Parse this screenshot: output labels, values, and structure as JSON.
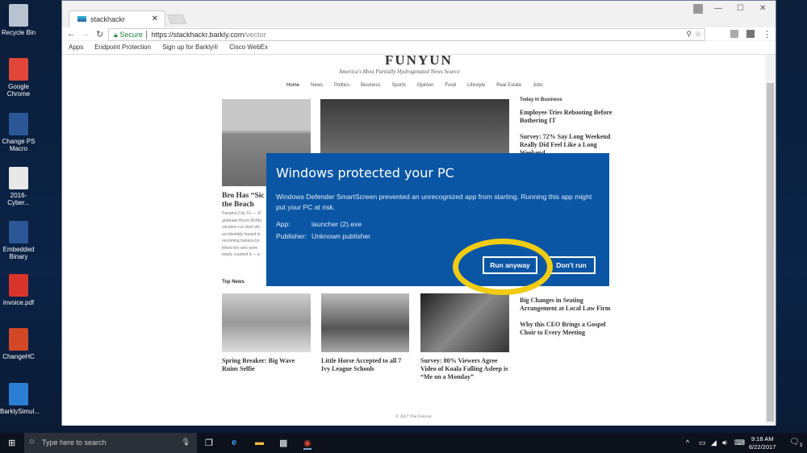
{
  "desktop": {
    "icons": [
      {
        "label": "Recycle Bin",
        "color": "#b7c3cf"
      },
      {
        "label": "Google Chrome",
        "color": "#e0463a"
      },
      {
        "label": "Change PS Macro",
        "color": "#2b5797"
      },
      {
        "label": "2016-Cyber...",
        "color": "#e8e8e8"
      },
      {
        "label": "Embedded Binary",
        "color": "#2b5797"
      },
      {
        "label": "invoice.pdf",
        "color": "#d9342b"
      },
      {
        "label": "ChangeHC",
        "color": "#d24726"
      },
      {
        "label": "BarklySimul...",
        "color": "#2a7fd4"
      }
    ]
  },
  "browser": {
    "tab_title": "stackhackr",
    "secure_label": "Secure",
    "url_host": "https://stackhackr.barkly.com",
    "url_path": "/vector",
    "bookmarks": [
      "Apps",
      "Endpoint Protection",
      "Sign up for Barkly®",
      "Cisco WebEx"
    ]
  },
  "site": {
    "logo": "FUNYUN",
    "tagline": "America's Most Partially Hydrogenated News Source",
    "menu": [
      "Home",
      "News",
      "Politics",
      "Business",
      "Sports",
      "Opinion",
      "Food",
      "Lifestyle",
      "Real Estate",
      "Jobs"
    ],
    "lead_headline": "Bro Has “Sic the Beach",
    "lead_excerpt": [
      "Panama City, FL — R",
      "graduate Bryce McMa",
      "vacation cut short wh",
      "accidentally tossed in",
      "oncoming banana bo",
      "fellow bro who were",
      "totally crushed it — a"
    ],
    "sidebar_title": "Today in Business",
    "sidebar_items": [
      "Employee Tries Rebooting Before Bothering IT",
      "Survey: 72% Say Long Weekend Really Did Feel Like a Long Weekend",
      "Big Changes in Seating Arrangement at Local Law Firm",
      "Why this CEO Brings a Gospel Choir to Every Meeting"
    ],
    "top_news_title": "Top News",
    "top_news": [
      "Spring Breaker: Big Wave Ruins Selfie",
      "Little Horse Accepted to all 7 Ivy League Schools",
      "Survey: 80% Viewers Agree Video of Koala Falling Asleep is “Me on a Monday”"
    ],
    "footer": "© 2017 The Funyun"
  },
  "dialog": {
    "title": "Windows protected your PC",
    "message": "Windows Defender SmartScreen prevented an unrecognized app from starting. Running this app might put your PC at risk.",
    "app_label": "App:",
    "app_value": "launcher (2).exe",
    "publisher_label": "Publisher:",
    "publisher_value": "Unknown publisher",
    "run_anyway": "Run anyway",
    "dont_run": "Don't run",
    "highlight_color": "#f2cc11"
  },
  "taskbar": {
    "search_placeholder": "Type here to search",
    "time": "9:18 AM",
    "date": "6/22/2017",
    "notifications": "3"
  }
}
